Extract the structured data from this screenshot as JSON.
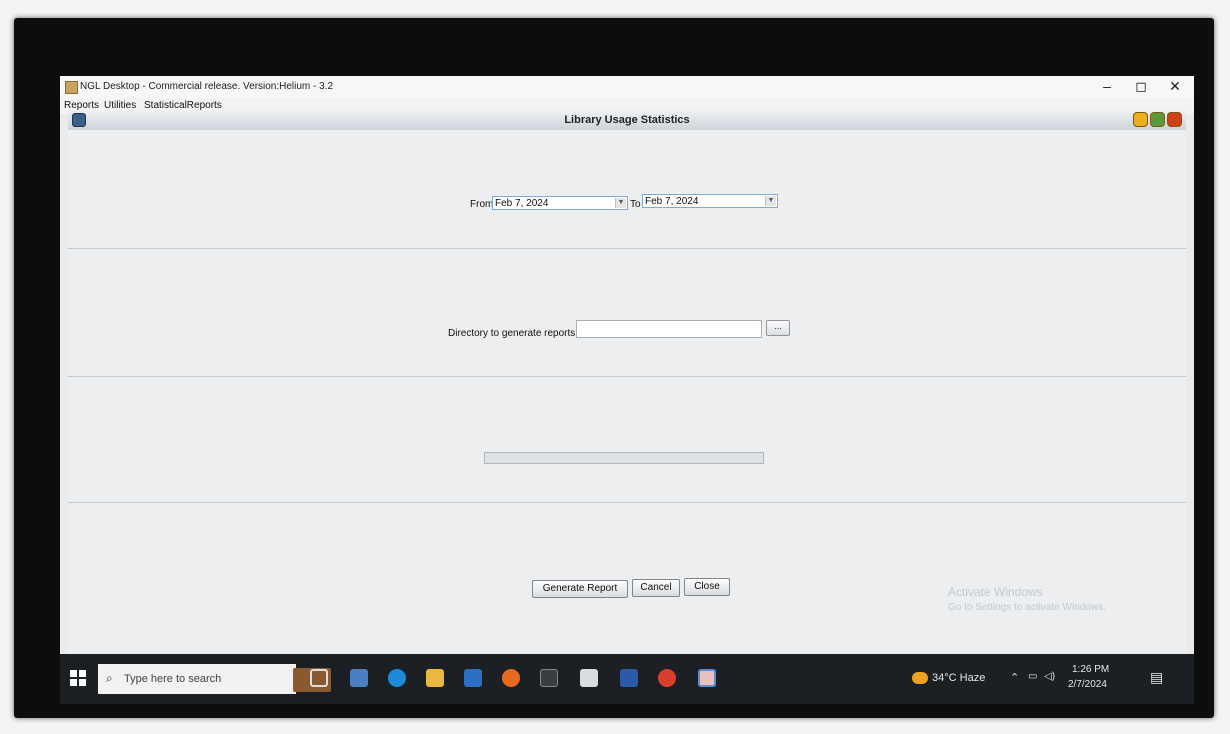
{
  "window": {
    "title": "NGL Desktop - Commercial release. Version:Helium - 3.2",
    "controls": {
      "minimize": "–",
      "maximize": "◻",
      "close": "✕"
    }
  },
  "menu": {
    "items": [
      "Reports",
      "Utilities",
      "StatisticalReports"
    ]
  },
  "iframe": {
    "title": "Library Usage Statistics"
  },
  "form": {
    "from_label": "From",
    "from_value": "Feb 7, 2024",
    "to_label": "To",
    "to_value": "Feb 7, 2024",
    "directory_label": "Directory to generate reports",
    "directory_value": "",
    "browse_label": "...",
    "progress": 0
  },
  "buttons": {
    "generate": "Generate Report",
    "cancel": "Cancel",
    "close": "Close"
  },
  "watermark": {
    "line1": "Activate Windows",
    "line2": "Go to Settings to activate Windows."
  },
  "taskbar": {
    "search_placeholder": "Type here to search",
    "weather": "34°C  Haze",
    "time": "1:26 PM",
    "date": "2/7/2024"
  },
  "colors": {
    "iframe_btn_min": "#e8b020",
    "iframe_btn_max": "#5a9a3a",
    "iframe_btn_close": "#d04018",
    "field_focus_border": "#7ea9d8"
  }
}
